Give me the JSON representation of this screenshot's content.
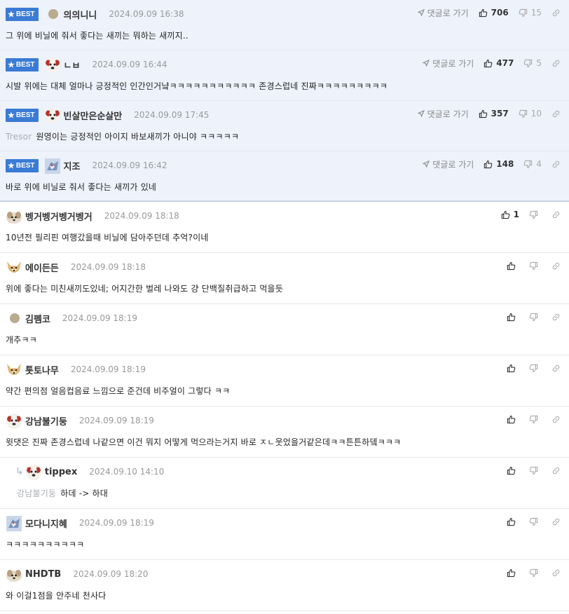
{
  "ui": {
    "best_label": "BEST",
    "goto_label": "댓글로 가기"
  },
  "comments": [
    {
      "nick": "의의니니",
      "date": "2024.09.09 16:38",
      "text": "그 위에 비닐에 줘서 좋다는 새끼는 뭐하는 새끼지..",
      "likes": "706",
      "dislikes": "15",
      "avatar": "dot"
    },
    {
      "nick": "ㄴㅂ",
      "date": "2024.09.09 16:44",
      "text": "시발 위에는 대체 얼마나 긍정적인 인간인거냨ㅋㅋㅋㅋㅋㅋㅋㅋㅋㅋㅋ 존경스럽네 진짜ㅋㅋㅋㅋㅋㅋㅋㅋㅋ",
      "likes": "477",
      "dislikes": "5",
      "avatar": "dog-red"
    },
    {
      "nick": "빈살만은순살만",
      "date": "2024.09.09 17:45",
      "ref": "Tresor",
      "text": "원영이는 긍정적인 아이지 바보새끼가 아니야 ㅋㅋㅋㅋㅋ",
      "likes": "357",
      "dislikes": "10",
      "avatar": "dog-red"
    },
    {
      "nick": "지조",
      "date": "2024.09.09 16:42",
      "text": "바로 위에 비닐로 줘서 좋다는 새끼가 있네",
      "likes": "148",
      "dislikes": "4",
      "avatar": "bird"
    },
    {
      "nick": "벵거벵거벵거벵거",
      "date": "2024.09.09 18:18",
      "text": "10년전 필리핀 여행갔을때 비닐에 담아주던데 추억?이네",
      "likes": "1",
      "avatar": "pup"
    },
    {
      "nick": "에이든든",
      "date": "2024.09.09 18:18",
      "text": "위에 좋다는 미친새끼도있네; 어지간한 벌레 나와도 걍 단백질취급하고 먹을듯",
      "likes": "",
      "avatar": "fox"
    },
    {
      "nick": "김펨코",
      "date": "2024.09.09 18:19",
      "text": "개추ㅋㅋ",
      "likes": "",
      "avatar": "dot"
    },
    {
      "nick": "톳토나무",
      "date": "2024.09.09 18:19",
      "text": "약간 편의점 얼음컵음료 느낌으로 준건데 비주얼이 그렇다 ㅋㅋ",
      "likes": "",
      "avatar": "fox"
    },
    {
      "nick": "강남불기둥",
      "date": "2024.09.09 18:19",
      "text": "윗댓은 진짜 존경스럽네 나같으면 이건 뭐지 어떻게 먹으라는거지 바로 ㅈㄴ웃었을거같은데ㅋㅋ튼튼하뎈ㅋㅋㅋ",
      "likes": "",
      "avatar": "dog-red"
    },
    {
      "nick": "tippex",
      "date": "2024.09.10 14:10",
      "ref": "강남불기둥",
      "text": "하데 -> 하대",
      "likes": "",
      "avatar": "dog-red",
      "reply": true
    },
    {
      "nick": "모다니지혜",
      "date": "2024.09.09 18:19",
      "text": "ㅋㅋㅋㅋㅋㅋㅋㅋㅋㅋ",
      "likes": "",
      "avatar": "bird"
    },
    {
      "nick": "NHDTB",
      "date": "2024.09.09 18:20",
      "text": "와 이걸1점을 안주네 천사다",
      "likes": "",
      "avatar": "pup"
    }
  ]
}
